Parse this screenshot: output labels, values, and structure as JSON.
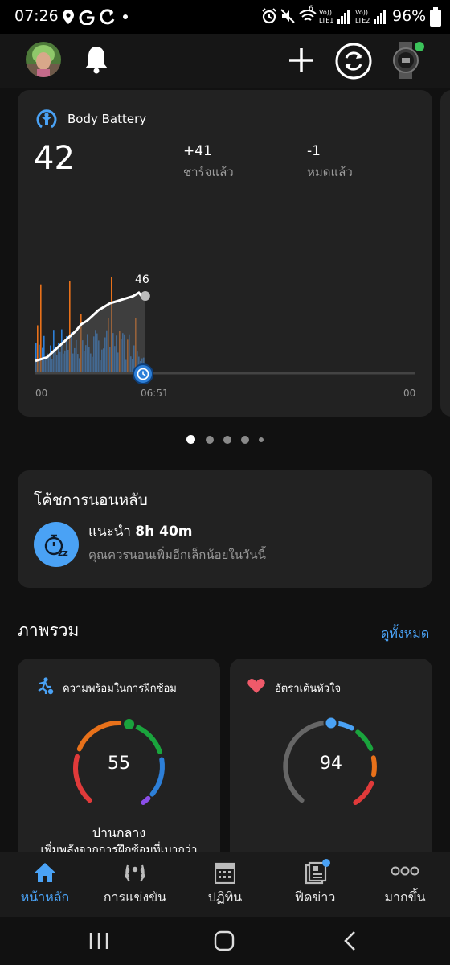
{
  "status_bar": {
    "time": "07:26",
    "left_icons": [
      "location-icon",
      "google-icon",
      "sync-icon",
      "dot-icon"
    ],
    "right_icons": [
      "alarm-icon",
      "mute-icon",
      "wifi-icon",
      "signal-icon",
      "signal-icon"
    ],
    "lte1": "LTE1",
    "lte2": "LTE2",
    "volte": "Vo))",
    "wifi_num": "6",
    "battery": "96%"
  },
  "top_bar": {
    "icons": [
      "avatar",
      "bell-icon",
      "plus-icon",
      "sync-icon",
      "watch-icon"
    ]
  },
  "body_battery": {
    "title": "Body Battery",
    "value": "42",
    "charged_value": "+41",
    "charged_label": "ชาร์จแล้ว",
    "drained_value": "-1",
    "drained_label": "หมดแล้ว",
    "chart_peak": "46",
    "x_start": "00",
    "x_now": "06:51",
    "x_end": "00"
  },
  "chart_data": {
    "type": "area",
    "title": "",
    "xlabel": "",
    "ylabel": "",
    "x_tick_labels": [
      "00",
      "06:51",
      "00"
    ],
    "peak_label": "46",
    "series": [
      {
        "values": [
          7,
          8,
          9,
          12,
          15,
          18,
          21,
          24,
          28,
          30,
          33,
          36,
          38,
          40,
          41,
          42,
          43,
          44,
          46,
          42
        ]
      }
    ]
  },
  "page_dots": 5,
  "sleep_coach": {
    "title": "โค้ชการนอนหลับ",
    "rec_prefix": "แนะนำ",
    "rec_value": "8h 40m",
    "subtitle": "คุณควรนอนเพิ่มอีกเล็กน้อยในวันนี้"
  },
  "overview": {
    "title": "ภาพรวม",
    "see_all": "ดูทั้งหมด"
  },
  "training_readiness": {
    "title": "ความพร้อมในการฝึกซ้อม",
    "value": "55",
    "level": 0.55,
    "status": "ปานกลาง",
    "desc": "เพิ่มพลังจากการฝึกซ้อมที่เบากว่า"
  },
  "heart_rate": {
    "title": "อัตราเต้นหัวใจ",
    "value": "94"
  },
  "bottom_nav": [
    {
      "label": "หน้าหลัก",
      "icon": "home-icon"
    },
    {
      "label": "การแข่งขัน",
      "icon": "laurel-icon"
    },
    {
      "label": "ปฏิทิน",
      "icon": "calendar-icon"
    },
    {
      "label": "ฟีดข่าว",
      "icon": "news-icon"
    },
    {
      "label": "มากขึ้น",
      "icon": "more-icon"
    }
  ],
  "colors": {
    "accent": "#4aa2f5",
    "card": "#222222",
    "orange": "#e8711a",
    "green": "#1aa43d",
    "red": "#e03a3a",
    "blue": "#2d7fd8",
    "purple": "#8a4ee8"
  }
}
